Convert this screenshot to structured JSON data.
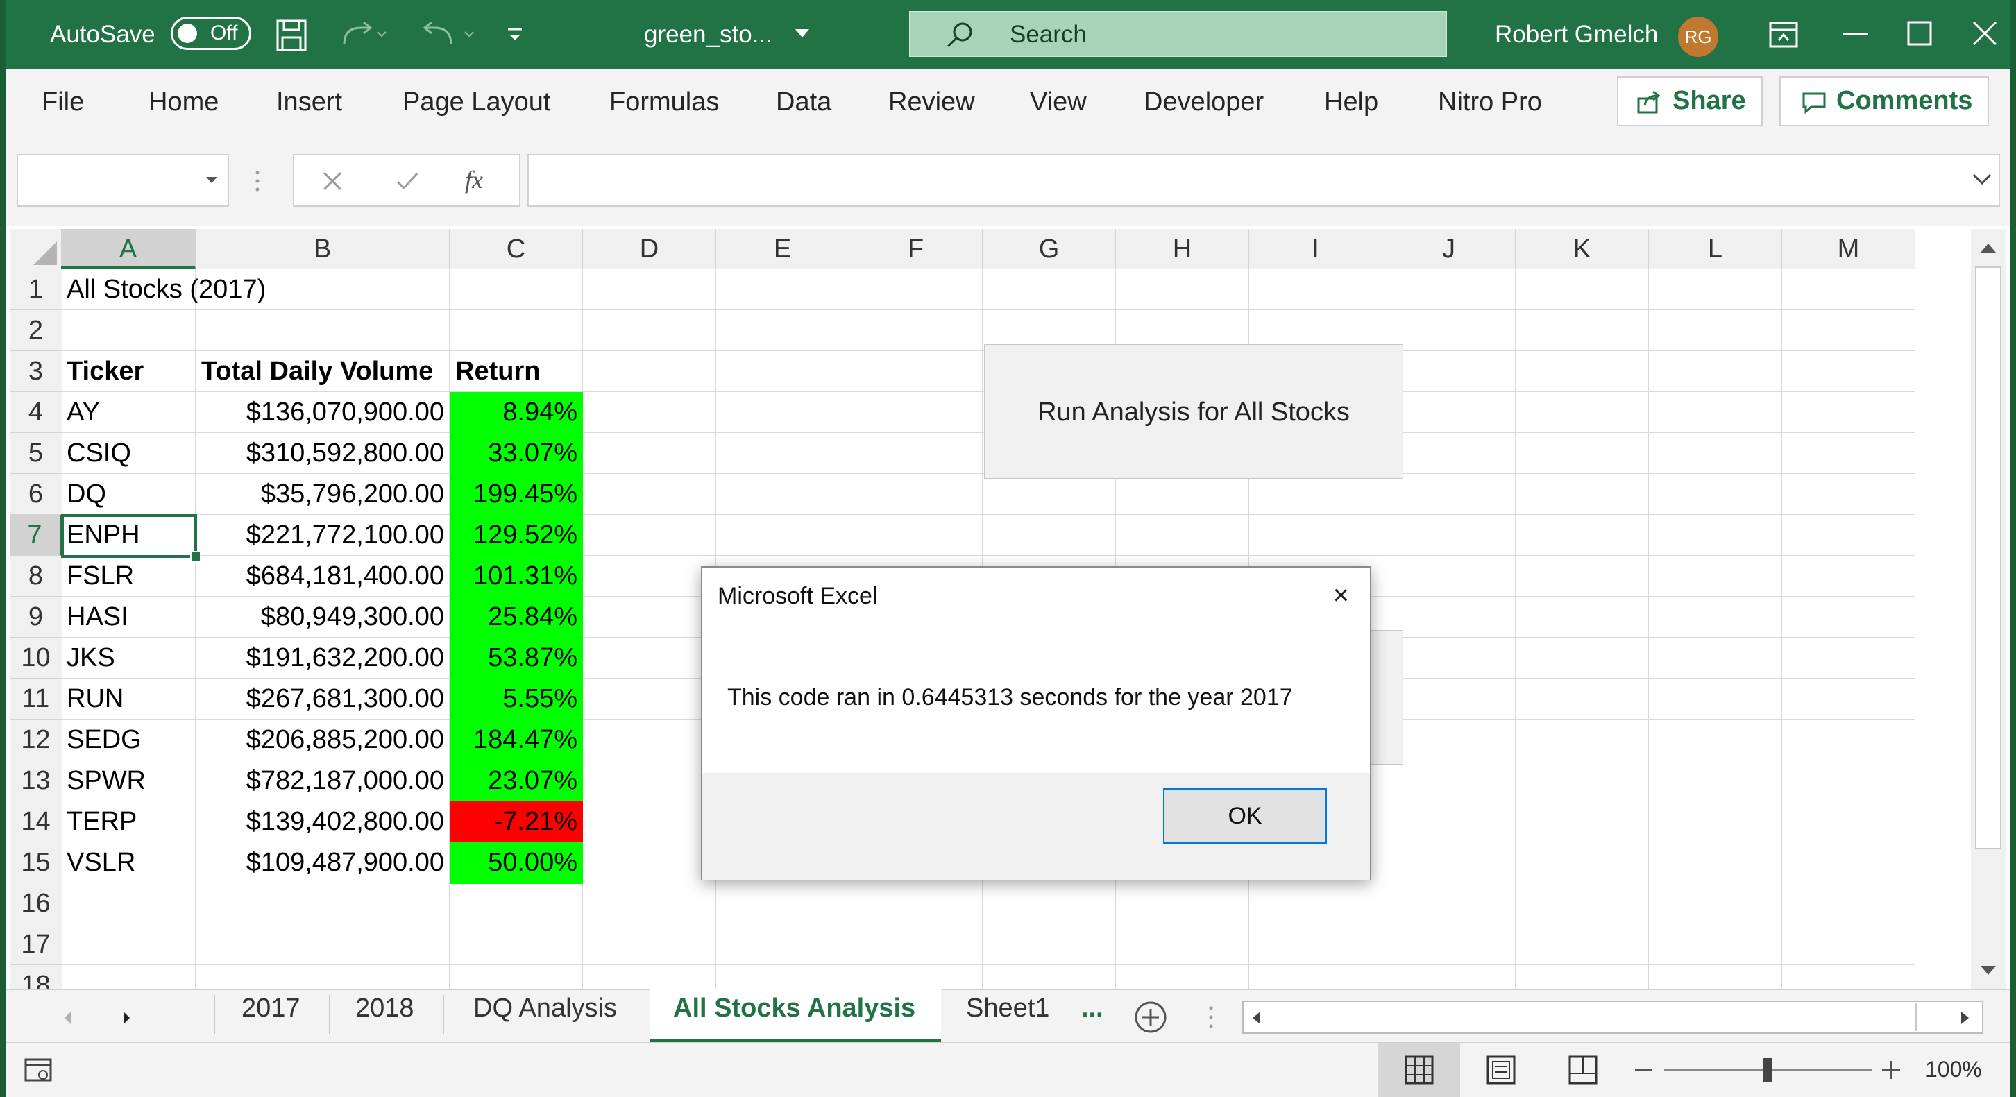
{
  "titlebar": {
    "autosave_label": "AutoSave",
    "autosave_state": "Off",
    "filename": "green_sto...",
    "search_placeholder": "Search",
    "user_name": "Robert Gmelch",
    "user_initials": "RG"
  },
  "ribbon": {
    "tabs": [
      "File",
      "Home",
      "Insert",
      "Page Layout",
      "Formulas",
      "Data",
      "Review",
      "View",
      "Developer",
      "Help",
      "Nitro Pro"
    ],
    "share_label": "Share",
    "comments_label": "Comments"
  },
  "formula_bar": {
    "name_box": "",
    "fx_label": "fx",
    "value": ""
  },
  "grid": {
    "columns": [
      "A",
      "B",
      "C",
      "D",
      "E",
      "F",
      "G",
      "H",
      "I",
      "J",
      "K",
      "L",
      "M"
    ],
    "selected_column": "A",
    "selected_row": "7",
    "title": "All Stocks (2017)",
    "headers": {
      "ticker": "Ticker",
      "volume": "Total Daily Volume",
      "return": "Return"
    },
    "rows": [
      {
        "row": "4",
        "ticker": "AY",
        "volume": "$136,070,900.00",
        "return": "8.94%",
        "return_color": "#00ff00"
      },
      {
        "row": "5",
        "ticker": "CSIQ",
        "volume": "$310,592,800.00",
        "return": "33.07%",
        "return_color": "#00ff00"
      },
      {
        "row": "6",
        "ticker": "DQ",
        "volume": "$35,796,200.00",
        "return": "199.45%",
        "return_color": "#00ff00"
      },
      {
        "row": "7",
        "ticker": "ENPH",
        "volume": "$221,772,100.00",
        "return": "129.52%",
        "return_color": "#00ff00"
      },
      {
        "row": "8",
        "ticker": "FSLR",
        "volume": "$684,181,400.00",
        "return": "101.31%",
        "return_color": "#00ff00"
      },
      {
        "row": "9",
        "ticker": "HASI",
        "volume": "$80,949,300.00",
        "return": "25.84%",
        "return_color": "#00ff00"
      },
      {
        "row": "10",
        "ticker": "JKS",
        "volume": "$191,632,200.00",
        "return": "53.87%",
        "return_color": "#00ff00"
      },
      {
        "row": "11",
        "ticker": "RUN",
        "volume": "$267,681,300.00",
        "return": "5.55%",
        "return_color": "#00ff00"
      },
      {
        "row": "12",
        "ticker": "SEDG",
        "volume": "$206,885,200.00",
        "return": "184.47%",
        "return_color": "#00ff00"
      },
      {
        "row": "13",
        "ticker": "SPWR",
        "volume": "$782,187,000.00",
        "return": "23.07%",
        "return_color": "#00ff00"
      },
      {
        "row": "14",
        "ticker": "TERP",
        "volume": "$139,402,800.00",
        "return": "-7.21%",
        "return_color": "#ff0000"
      },
      {
        "row": "15",
        "ticker": "VSLR",
        "volume": "$109,487,900.00",
        "return": "50.00%",
        "return_color": "#00ff00"
      }
    ]
  },
  "macro_button": {
    "label": "Run Analysis for All Stocks"
  },
  "dialog": {
    "title": "Microsoft Excel",
    "close": "×",
    "message": "This code ran in 0.6445313 seconds for the year 2017",
    "ok_label": "OK"
  },
  "sheet_tabs": {
    "tabs": [
      "2017",
      "2018",
      "DQ Analysis",
      "All Stocks Analysis",
      "Sheet1"
    ],
    "active": "All Stocks Analysis",
    "more": "..."
  },
  "status": {
    "zoom": "100%"
  },
  "colors": {
    "brand": "#217346",
    "positive": "#00ff00",
    "negative": "#ff0000"
  }
}
